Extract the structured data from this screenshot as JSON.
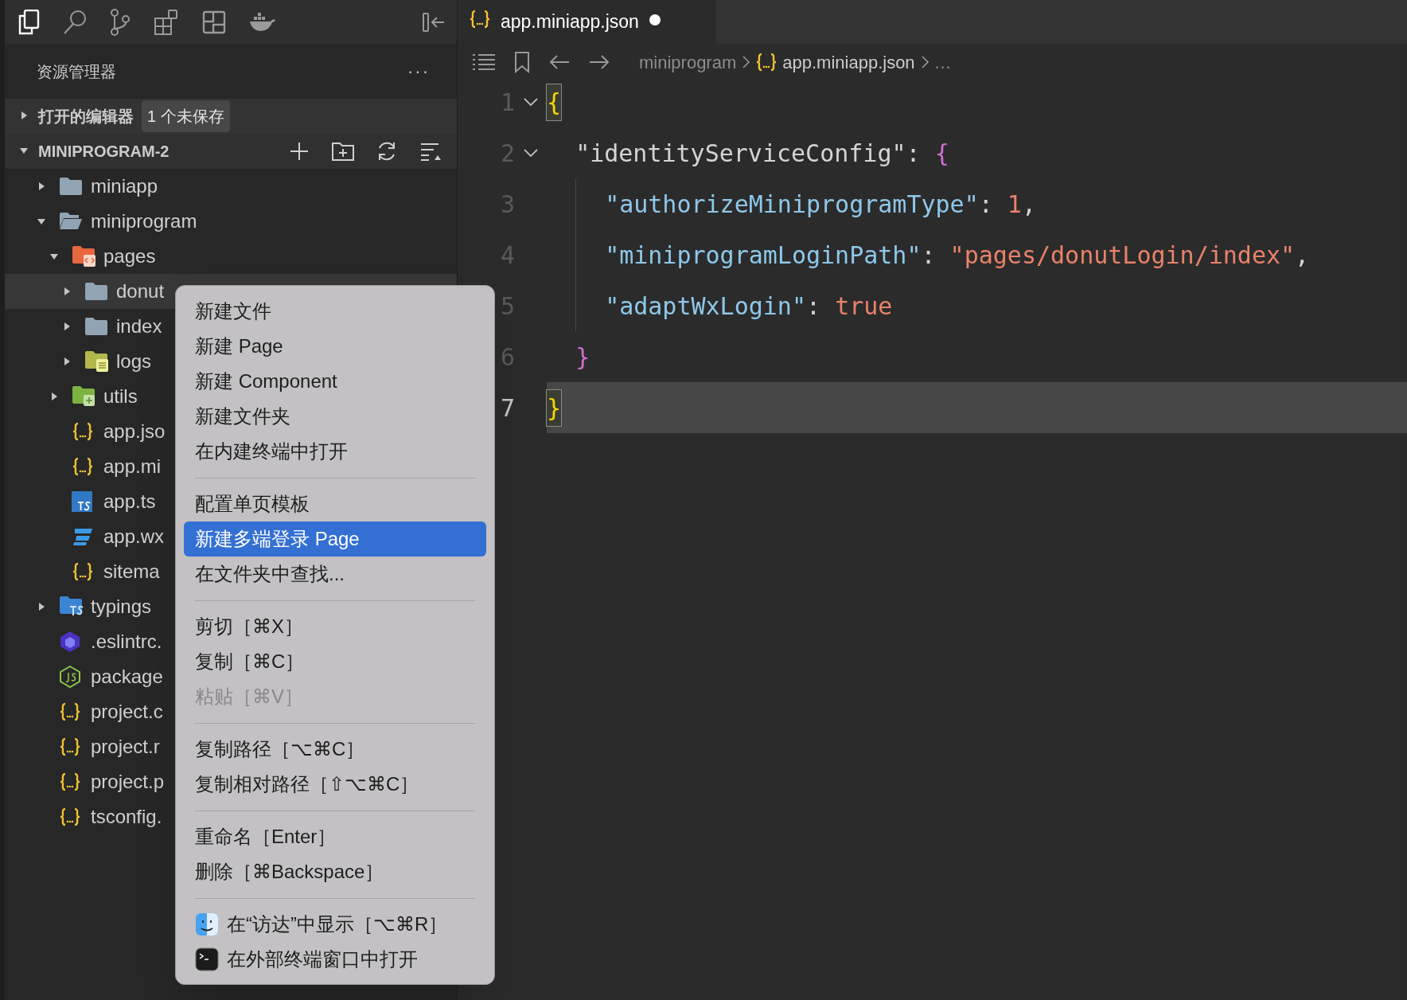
{
  "activity_bar": [
    {
      "kind": "files",
      "selected": true
    },
    {
      "kind": "search",
      "selected": false
    },
    {
      "kind": "branch",
      "selected": false
    },
    {
      "kind": "extensions",
      "selected": false
    },
    {
      "kind": "layout",
      "selected": false
    },
    {
      "kind": "whale",
      "selected": false
    }
  ],
  "sidebar": {
    "title": "资源管理器",
    "more": "···",
    "open_editors": {
      "label": "打开的编辑器",
      "badge": "1 个未保存",
      "expanded": false
    },
    "workspace": {
      "label": "MINIPROGRAM-2",
      "expanded": true
    },
    "tree": [
      {
        "name": "miniapp",
        "kind": "folder",
        "expanded": false,
        "selected": false
      },
      {
        "name": "miniprogram",
        "kind": "folder",
        "expanded": true,
        "selected": false,
        "children": [
          {
            "name": "pages",
            "kind": "pages",
            "expanded": true,
            "selected": false,
            "children": [
              {
                "name": "donut",
                "kind": "folder",
                "expanded": false,
                "selected": true
              },
              {
                "name": "index",
                "kind": "folder",
                "expanded": false,
                "selected": false
              },
              {
                "name": "logs",
                "kind": "logs",
                "expanded": false,
                "selected": false
              }
            ]
          },
          {
            "name": "utils",
            "kind": "utils",
            "expanded": false,
            "selected": false
          },
          {
            "name": "app.jso",
            "kind": "json",
            "selected": false
          },
          {
            "name": "app.mi",
            "kind": "json",
            "selected": false
          },
          {
            "name": "app.ts",
            "kind": "ts",
            "selected": false
          },
          {
            "name": "app.wx",
            "kind": "css",
            "selected": false
          },
          {
            "name": "sitema",
            "kind": "json",
            "selected": false
          }
        ]
      },
      {
        "name": "typings",
        "kind": "typings",
        "expanded": false,
        "selected": false
      },
      {
        "name": ".eslintrc.",
        "kind": "eslint",
        "selected": false
      },
      {
        "name": "package",
        "kind": "node",
        "selected": false
      },
      {
        "name": "project.c",
        "kind": "json",
        "selected": false
      },
      {
        "name": "project.r",
        "kind": "json",
        "selected": false
      },
      {
        "name": "project.p",
        "kind": "json",
        "selected": false
      },
      {
        "name": "tsconfig.",
        "kind": "json",
        "selected": false
      }
    ]
  },
  "editor": {
    "tab": {
      "title": "app.miniapp.json",
      "dirty": true
    },
    "breadcrumb": [
      "miniprogram",
      "app.miniapp.json",
      "…"
    ],
    "lines": [
      {
        "number": "1",
        "foldable": true,
        "current": false,
        "tokens": [
          {
            "kind": "bracket1",
            "text": "{",
            "matched": true
          }
        ]
      },
      {
        "number": "2",
        "foldable": true,
        "current": false,
        "tokens": [
          {
            "kind": "plain",
            "text": "  \"identityServiceConfig\": "
          },
          {
            "kind": "bracket2",
            "text": "{",
            "matched": false
          }
        ]
      },
      {
        "number": "3",
        "foldable": false,
        "current": false,
        "tokens": [
          {
            "kind": "property",
            "text": "    \"authorizeMiniprogramType\""
          },
          {
            "kind": "plain",
            "text": ": "
          },
          {
            "kind": "value",
            "text": "1"
          },
          {
            "kind": "plain",
            "text": ","
          }
        ]
      },
      {
        "number": "4",
        "foldable": false,
        "current": false,
        "tokens": [
          {
            "kind": "property",
            "text": "    \"miniprogramLoginPath\""
          },
          {
            "kind": "plain",
            "text": ": "
          },
          {
            "kind": "value",
            "text": "\"pages/donutLogin/index\""
          },
          {
            "kind": "plain",
            "text": ","
          }
        ]
      },
      {
        "number": "5",
        "foldable": false,
        "current": false,
        "tokens": [
          {
            "kind": "property",
            "text": "    \"adaptWxLogin\""
          },
          {
            "kind": "plain",
            "text": ": "
          },
          {
            "kind": "value",
            "text": "true"
          }
        ]
      },
      {
        "number": "6",
        "foldable": false,
        "current": false,
        "tokens": [
          {
            "kind": "bracket2",
            "text": "  }",
            "matched": false
          }
        ]
      },
      {
        "number": "7",
        "foldable": false,
        "current": true,
        "tokens": [
          {
            "kind": "bracket1",
            "text": "}",
            "matched": true
          }
        ]
      }
    ]
  },
  "context_menu": [
    [
      {
        "label": "新建文件",
        "disabled": false,
        "selected": false
      },
      {
        "label": "新建 Page",
        "disabled": false,
        "selected": false
      },
      {
        "label": "新建 Component",
        "disabled": false,
        "selected": false
      },
      {
        "label": "新建文件夹",
        "disabled": false,
        "selected": false
      },
      {
        "label": "在内建终端中打开",
        "disabled": false,
        "selected": false
      }
    ],
    [
      {
        "label": "配置单页模板",
        "disabled": false,
        "selected": false
      },
      {
        "label": "新建多端登录 Page",
        "disabled": false,
        "selected": true
      },
      {
        "label": "在文件夹中查找...",
        "disabled": false,
        "selected": false
      }
    ],
    [
      {
        "label": "剪切［⌘X］",
        "disabled": false,
        "selected": false
      },
      {
        "label": "复制［⌘C］",
        "disabled": false,
        "selected": false
      },
      {
        "label": "粘贴［⌘V］",
        "disabled": true,
        "selected": false
      }
    ],
    [
      {
        "label": "复制路径［⌥⌘C］",
        "disabled": false,
        "selected": false
      },
      {
        "label": "复制相对路径［⇧⌥⌘C］",
        "disabled": false,
        "selected": false
      }
    ],
    [
      {
        "label": "重命名［Enter］",
        "disabled": false,
        "selected": false
      },
      {
        "label": "删除［⌘Backspace］",
        "disabled": false,
        "selected": false
      }
    ],
    [
      {
        "label": "在“访达”中显示［⌥⌘R］",
        "disabled": false,
        "selected": false,
        "kind": "finder"
      },
      {
        "label": "在外部终端窗口中打开",
        "disabled": false,
        "selected": false,
        "kind": "terminal"
      }
    ]
  ]
}
